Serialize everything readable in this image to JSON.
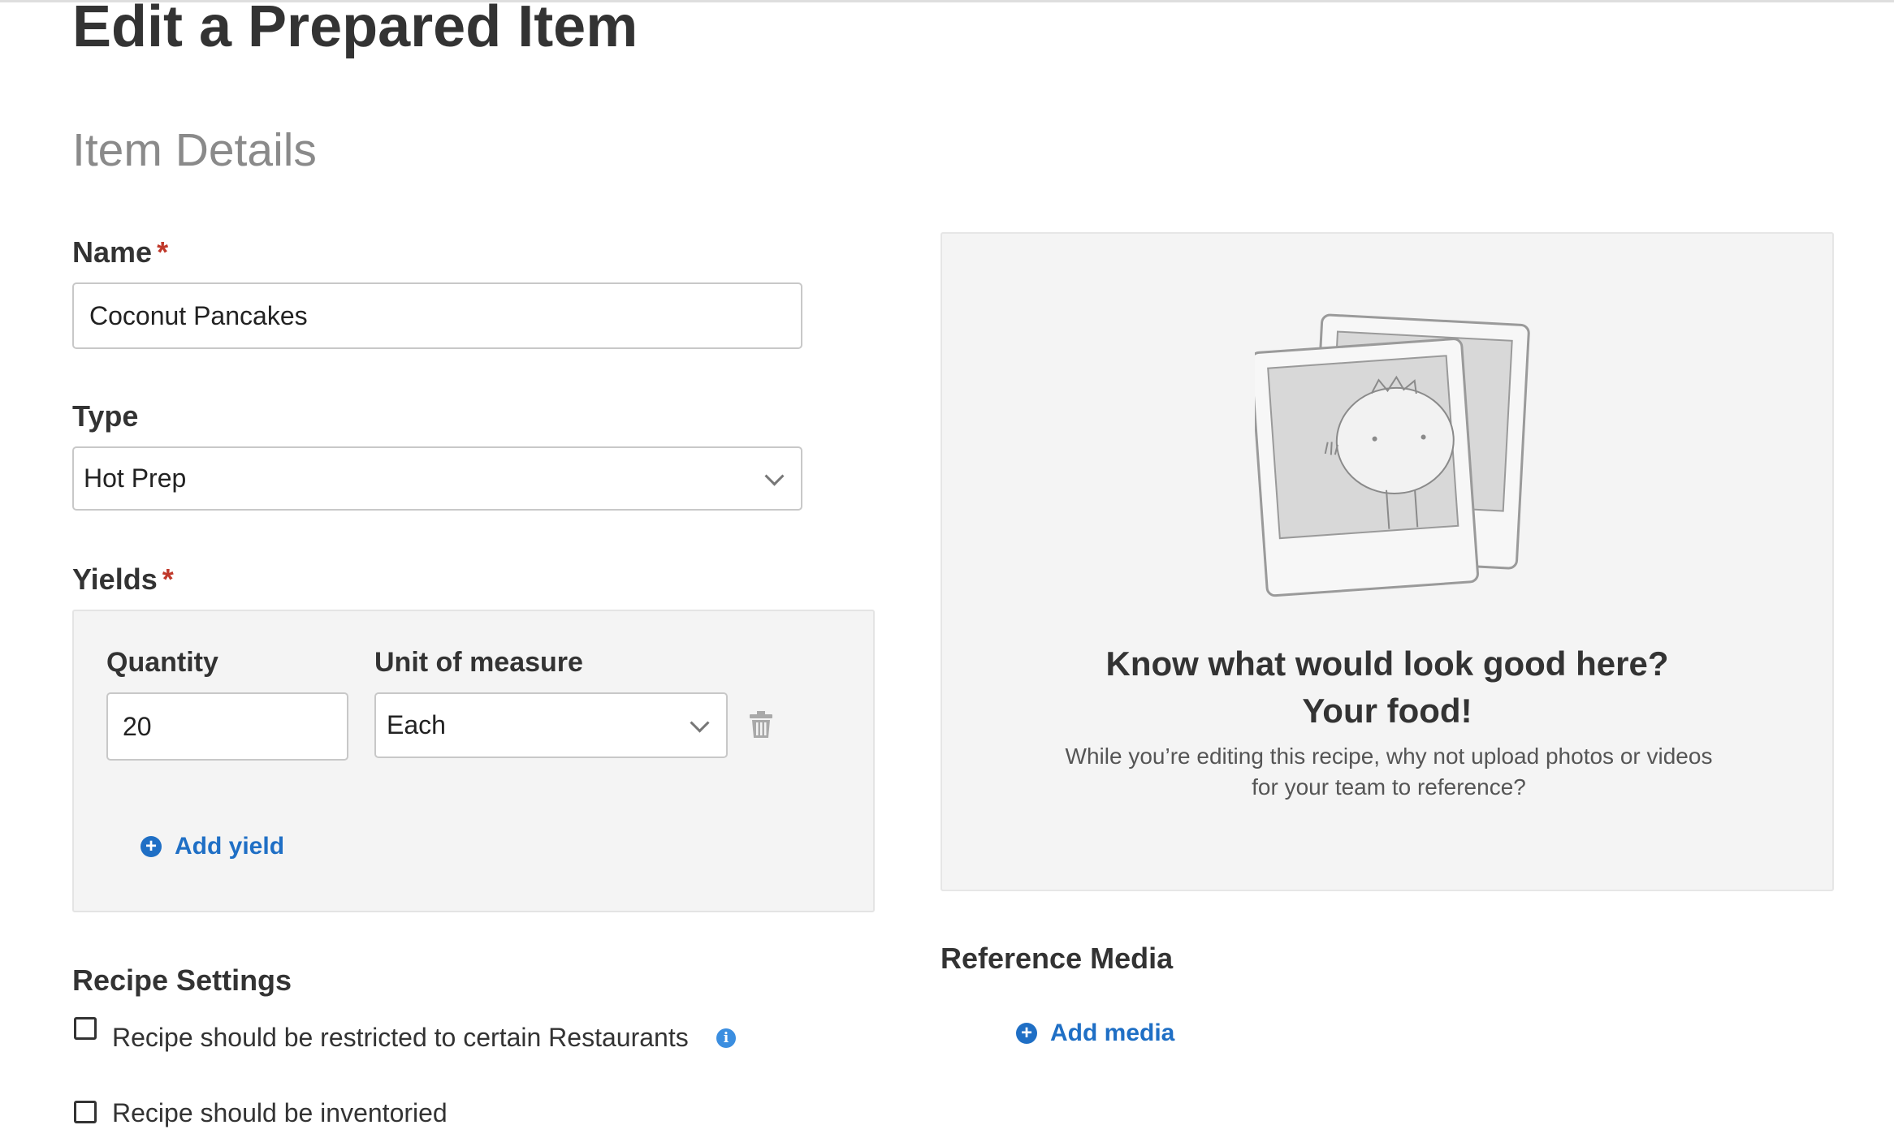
{
  "page": {
    "title": "Edit a Prepared Item",
    "section": "Item Details"
  },
  "name_field": {
    "label": "Name",
    "required_mark": "*",
    "value": "Coconut Pancakes"
  },
  "type_field": {
    "label": "Type",
    "value": "Hot Prep"
  },
  "yields": {
    "label": "Yields",
    "required_mark": "*",
    "quantity_label": "Quantity",
    "unit_label": "Unit of measure",
    "quantity_value": "20",
    "unit_value": "Each",
    "add_label": "Add yield"
  },
  "recipe_settings": {
    "title": "Recipe Settings",
    "options": [
      {
        "label": "Recipe should be restricted to certain Restaurants",
        "checked": false
      },
      {
        "label": "Recipe should be inventoried",
        "checked": false
      }
    ]
  },
  "media_panel": {
    "headline_1": "Know what would look good here?",
    "headline_2": "Your food!",
    "subtext": "While you’re editing this recipe, why not upload photos or videos for your team to reference?"
  },
  "reference_media": {
    "title": "Reference Media",
    "add_label": "Add media"
  },
  "icons": {
    "required": "asterisk",
    "select": "chevron-down-icon",
    "delete": "trash-icon",
    "add": "plus-circle-icon",
    "info": "info-icon",
    "placeholder": "photo-frames-illustration"
  },
  "colors": {
    "accent": "#1f6fc5",
    "required": "#c0392b",
    "panel_bg": "#f4f4f4",
    "info": "#3b8ee0"
  }
}
